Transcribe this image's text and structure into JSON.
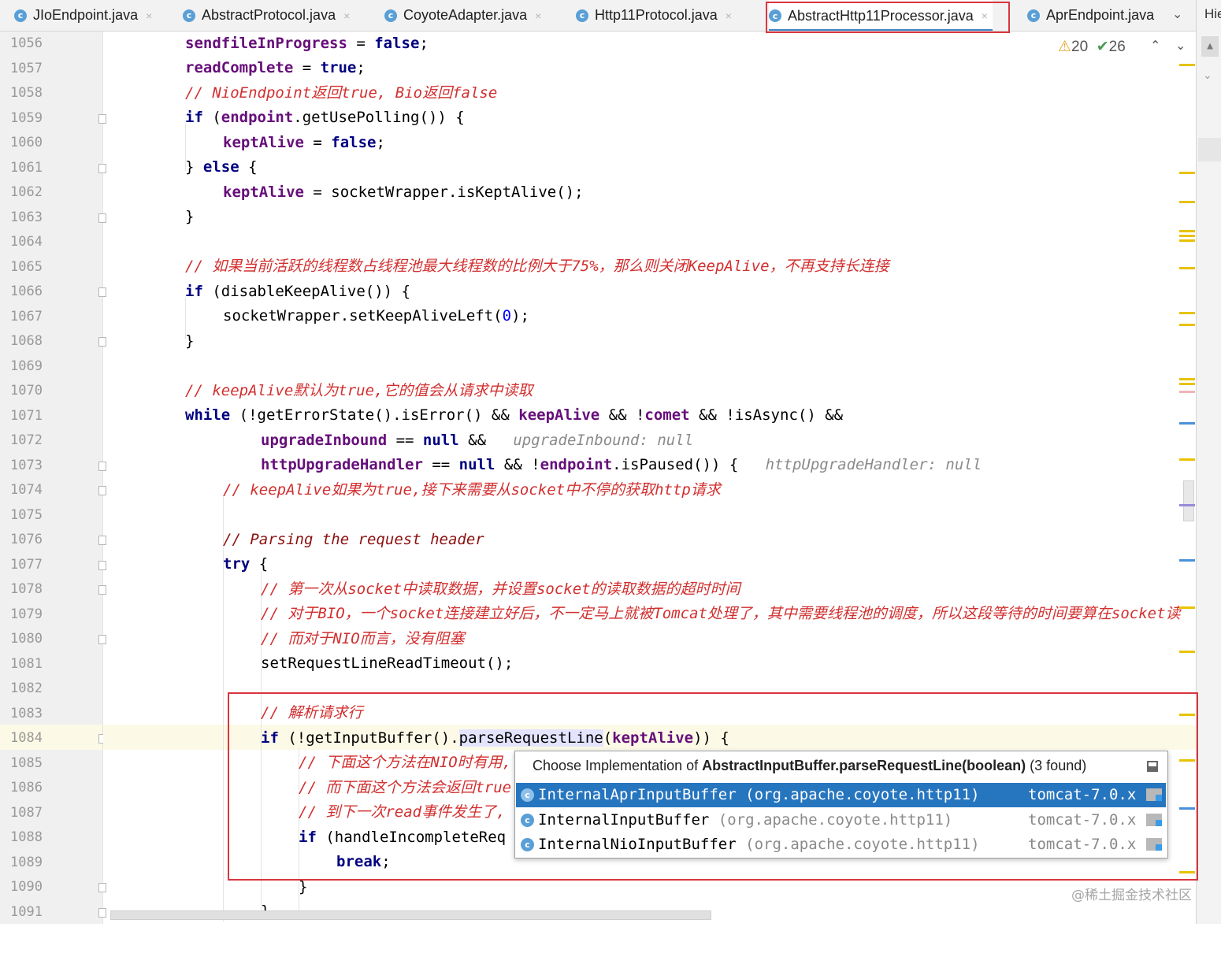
{
  "tabs": [
    {
      "icon": "class-icon",
      "label": "JIoEndpoint.java",
      "close": "×"
    },
    {
      "icon": "class-icon",
      "label": "AbstractProtocol.java",
      "close": "×"
    },
    {
      "icon": "class-icon",
      "label": "CoyoteAdapter.java",
      "close": "×"
    },
    {
      "icon": "class-icon",
      "label": "Http11Protocol.java",
      "close": "×"
    },
    {
      "icon": "class-icon",
      "label": "AbstractHttp11Processor.java",
      "close": "×",
      "active": true
    },
    {
      "icon": "class-icon",
      "label": "AprEndpoint.java",
      "close": ""
    }
  ],
  "tab_chevron": "⌄",
  "right_panel_label": "Hie",
  "inspection": {
    "warnings": "20",
    "ok": "26",
    "warn_icon": "⚠",
    "ok_icon": "✔",
    "up": "⌃",
    "down": "⌄"
  },
  "class_icon_letter": "c",
  "line_numbers": [
    "1056",
    "1057",
    "1058",
    "1059",
    "1060",
    "1061",
    "1062",
    "1063",
    "1064",
    "1065",
    "1066",
    "1067",
    "1068",
    "1069",
    "1070",
    "1071",
    "1072",
    "1073",
    "1074",
    "1075",
    "1076",
    "1077",
    "1078",
    "1079",
    "1080",
    "1081",
    "1082",
    "1083",
    "1084",
    "1085",
    "1086",
    "1087",
    "1088",
    "1089",
    "1090",
    "1091"
  ],
  "code": {
    "l1056": [
      "sendfileInProgress",
      " = ",
      "false",
      ";"
    ],
    "l1057": [
      "readComplete",
      " = ",
      "true",
      ";"
    ],
    "l1058": "// NioEndpoint返回true, Bio返回false",
    "l1059": [
      "if",
      " (",
      "endpoint",
      ".getUsePolling()) {"
    ],
    "l1060": [
      "keptAlive",
      " = ",
      "false",
      ";"
    ],
    "l1061": [
      "} ",
      "else",
      " {"
    ],
    "l1062": [
      "keptAlive",
      " = socketWrapper.isKeptAlive();"
    ],
    "l1063": "}",
    "l1065": "// 如果当前活跃的线程数占线程池最大线程数的比例大于75%，那么则关闭KeepAlive，不再支持长连接",
    "l1066": [
      "if",
      " (disableKeepAlive()) {"
    ],
    "l1067": [
      "socketWrapper.setKeepAliveLeft(",
      "0",
      ");"
    ],
    "l1068": "}",
    "l1070": "// keepAlive默认为true,它的值会从请求中读取",
    "l1071": [
      "while",
      " (!getErrorState().isError() && ",
      "keepAlive",
      " && !",
      "comet",
      " && !isAsync() &&"
    ],
    "l1072": [
      "upgradeInbound",
      " == ",
      "null",
      " &&",
      "upgradeInbound: null"
    ],
    "l1073": [
      "httpUpgradeHandler",
      " == ",
      "null",
      " && !",
      "endpoint",
      ".isPaused()) {",
      "httpUpgradeHandler: null"
    ],
    "l1074": "// keepAlive如果为true,接下来需要从socket中不停的获取http请求",
    "l1076": "// Parsing the request header",
    "l1077": [
      "try",
      " {"
    ],
    "l1078": "// 第一次从socket中读取数据，并设置socket的读取数据的超时时间",
    "l1079": "// 对于BIO，一个socket连接建立好后，不一定马上就被Tomcat处理了，其中需要线程池的调度，所以这段等待的时间要算在socket读",
    "l1080": "// 而对于NIO而言，没有阻塞",
    "l1081": "setRequestLineReadTimeout();",
    "l1083": "// 解析请求行",
    "l1084": [
      "if",
      " (!getInputBuffer().",
      "parseRequestLine",
      "(",
      "keptAlive",
      ")) {"
    ],
    "l1085": "// 下面这个方法在NIO时有用,",
    "l1086": "// 而下面这个方法会返回true",
    "l1087": "// 到下一次read事件发生了,",
    "l1088": [
      "if",
      " (handleIncompleteReq"
    ],
    "l1089": [
      "break",
      ";"
    ],
    "l1090": "}",
    "l1091": "}"
  },
  "popup": {
    "title_prefix": "Choose Implementation of ",
    "title_bold": "AbstractInputBuffer.parseRequestLine(boolean)",
    "title_suffix": " (3 found)",
    "rows": [
      {
        "name": "InternalAprInputBuffer",
        "pkg": "(org.apache.coyote.http11)",
        "module": "tomcat-7.0.x",
        "selected": true
      },
      {
        "name": "InternalInputBuffer",
        "pkg": "(org.apache.coyote.http11)",
        "module": "tomcat-7.0.x",
        "selected": false
      },
      {
        "name": "InternalNioInputBuffer",
        "pkg": "(org.apache.coyote.http11)",
        "module": "tomcat-7.0.x",
        "selected": false
      }
    ]
  },
  "watermark": "@稀土掘金技术社区",
  "colors": {
    "keyword": "#000080",
    "field": "#660e7a",
    "comment": "#d22f2f",
    "selection": "#2675bf",
    "highlight_box": "#d9363e"
  }
}
